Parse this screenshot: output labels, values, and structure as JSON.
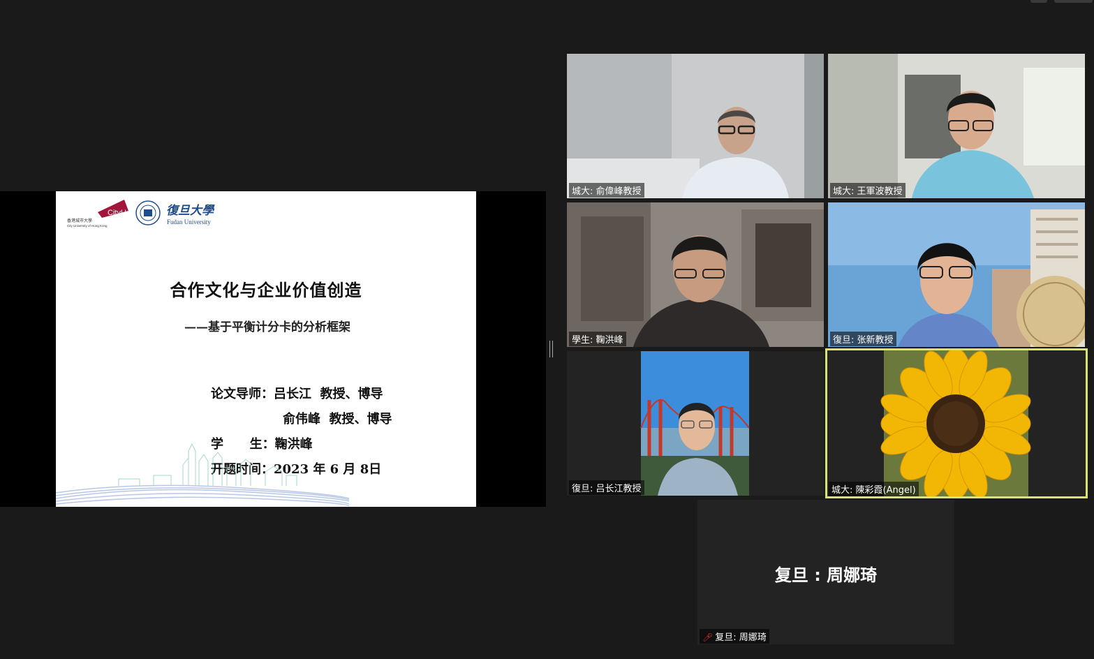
{
  "shared_slide": {
    "logo_cityu_text": "CityU",
    "logo_cityu_caption_zh": "香港城市大學",
    "logo_cityu_caption_en": "City University of Hong Kong",
    "logo_fudan_zh": "復旦大學",
    "logo_fudan_en": "Fudan University",
    "title": "合作文化与企业价值创造",
    "subtitle": "——基于平衡计分卡的分析框架",
    "advisor_line1": "论文导师：吕长江  教授、博导",
    "advisor_line2": "俞伟峰  教授、博导",
    "student_line": "学      生：鞠洪峰",
    "date_line": "开题时间：2023 年 6 月 8日"
  },
  "participants": [
    {
      "name": "城大: 俞偉峰教授"
    },
    {
      "name": "城大: 王軍波教授"
    },
    {
      "name": "學生: 鞠洪峰"
    },
    {
      "name": "復旦: 张新教授"
    },
    {
      "name": "復旦: 吕长江教授"
    },
    {
      "name": "城大: 陳彩霞(Angel)",
      "active_speaker": true
    },
    {
      "name": "复旦: 周娜琦",
      "display_name": "复旦 : 周娜琦",
      "muted": true,
      "video_off": true
    }
  ],
  "icons": {
    "muted": "mic-muted-icon"
  },
  "colors": {
    "active_border": "#d8e56a",
    "background": "#1a1a1a"
  }
}
